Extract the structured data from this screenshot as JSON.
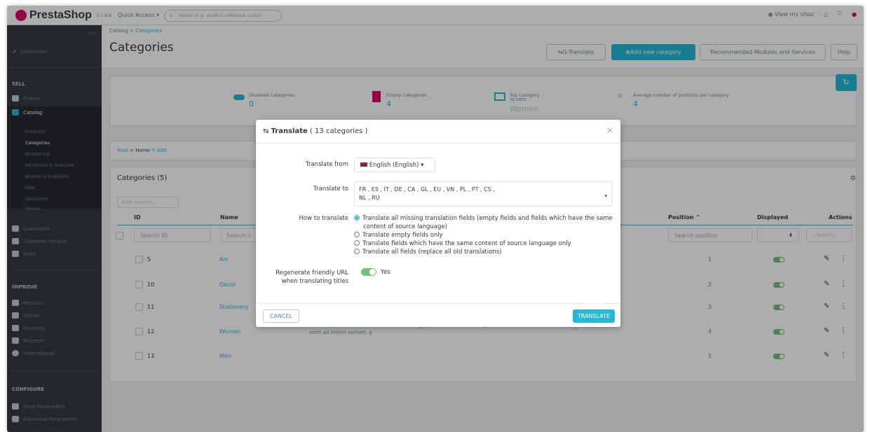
{
  "topbar": {
    "logo": "PrestaShop",
    "version": "1.7.8.9",
    "quick_access": "Quick Access ▾",
    "search_placeholder": "Search (e.g.: product reference, custon",
    "view_shop": "View my shop"
  },
  "sidebar": {
    "collapse": "<<",
    "dashboard": "Dashboard",
    "sec_sell": "SELL",
    "sell_items": [
      "Orders",
      "Catalog"
    ],
    "catalog_sub": [
      "Products",
      "Categories",
      "Monitoring",
      "Attributes & Features",
      "Brands & Suppliers",
      "Files",
      "Discounts",
      "Stocks"
    ],
    "sell_more": [
      "Customers",
      "Customer Service",
      "Stats"
    ],
    "sec_improve": "IMPROVE",
    "improve_items": [
      "Modules",
      "Design",
      "Shipping",
      "Payment",
      "International"
    ],
    "sec_configure": "CONFIGURE",
    "configure_items": [
      "Shop Parameters",
      "Advanced Parameters"
    ]
  },
  "header": {
    "breadcrumb_a": "Catalog",
    "breadcrumb_sep": ">",
    "breadcrumb_b": "Categories",
    "title": "Categories",
    "btn_gtranslate": "G-Translate",
    "btn_add": "Add new category",
    "btn_recommended": "Recommended Modules and Services",
    "btn_help": "Help"
  },
  "kpis": [
    {
      "label": "Disabled Categories",
      "value": "0"
    },
    {
      "label": "Empty Categories",
      "value": "4"
    },
    {
      "label": "Top Category",
      "sub": "30 DAYS",
      "value": "Women"
    },
    {
      "label": "Average number of products per category",
      "value": "4"
    }
  ],
  "tree": {
    "root": "Root",
    "sep": ">",
    "home": "Home",
    "edit": "Edit"
  },
  "table": {
    "title": "Categories (5)",
    "bulk": "Bulk actions",
    "headers": {
      "id": "ID",
      "name": "Name",
      "position": "Position",
      "displayed": "Displayed",
      "actions": "Actions"
    },
    "filters": {
      "id": "Search ID",
      "name": "Search n",
      "position": "Search position",
      "search_btn": "Search"
    },
    "rows": [
      {
        "id": "5",
        "name": "Art",
        "desc": "",
        "position": "1"
      },
      {
        "id": "10",
        "name": "Decor",
        "desc": "",
        "position": "2"
      },
      {
        "id": "11",
        "name": "Stationery",
        "desc": "",
        "position": "3"
      },
      {
        "id": "12",
        "name": "Women",
        "desc": "enim ad minim veniam, q",
        "position": "4"
      },
      {
        "id": "13",
        "name": "Men",
        "desc": "",
        "position": "5"
      }
    ],
    "desc_overflow": "...cing elit, sed do eiusmod tempor incididunt ut labore et dolore magna aliqua. Ut"
  },
  "modal": {
    "title_main": "Translate",
    "title_count": "( 13 categories )",
    "lbl_from": "Translate from",
    "from_value": "English (English)",
    "lbl_to": "Translate to",
    "to_line1": "FR , ES , IT , DE , CA , GL , EU , VN , PL , PT , CS ,",
    "to_line2": "NL , RU",
    "lbl_how": "How to translate",
    "opt1a": "Translate all missing translation fields (empty fields and fields which have the same",
    "opt1b": "content of source language)",
    "opt2": "Translate empty fields only",
    "opt3": "Translate fields which have the same content of source language only",
    "opt4": "Translate all fields (replace all old translations)",
    "lbl_regen1": "Regenerate friendly URL",
    "lbl_regen2": "when translating titles",
    "regen_value": "Yes",
    "cancel": "CANCEL",
    "translate": "TRANSLATE"
  },
  "colors": {
    "accent": "#25b9d7",
    "sidebar": "#363a41",
    "brand": "#df0067",
    "toggle": "#72c279"
  }
}
